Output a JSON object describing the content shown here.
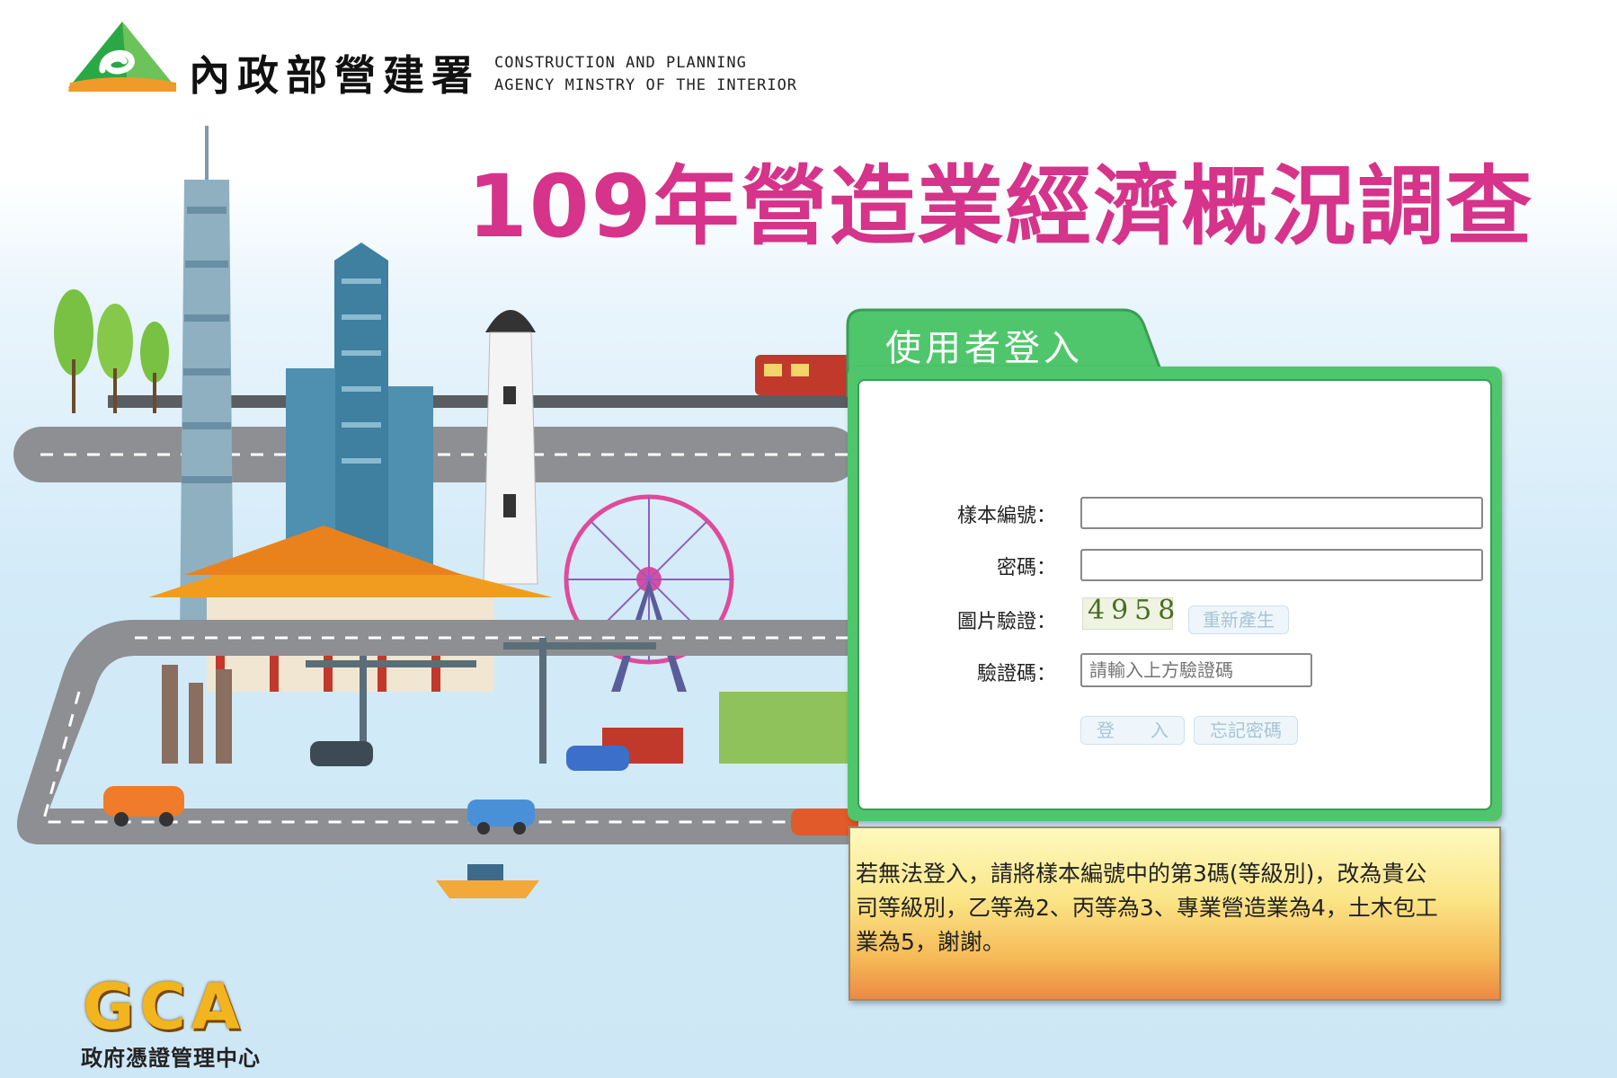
{
  "header": {
    "agency_name_zh": "內政部營建署",
    "agency_name_en_line1": "CONSTRUCTION AND PLANNING",
    "agency_name_en_line2": "AGENCY MINSTRY OF THE INTERIOR"
  },
  "survey": {
    "title": "109年營造業經濟概況調查"
  },
  "login": {
    "title": "使用者登入",
    "sample_id_label": "樣本編號：",
    "sample_id_value": "",
    "password_label": "密碼：",
    "password_value": "",
    "captcha_image_label": "圖片驗證：",
    "captcha_code": "4958",
    "regenerate_label": "重新產生",
    "captcha_input_label": "驗證碼：",
    "captcha_input_placeholder": "請輸入上方驗證碼",
    "captcha_input_value": "",
    "login_button_label": "登　　入",
    "forgot_password_label": "忘記密碼"
  },
  "notice": {
    "text": "若無法登入，請將樣本編號中的第3碼(等級別)，改為貴公司等級別，乙等為2、丙等為3、專業營造業為4，土木包工業為5，謝謝。"
  },
  "footer": {
    "gca_logo_text": "GCA",
    "gca_caption": "政府憑證管理中心"
  },
  "colors": {
    "title": "#d6338a",
    "login_green": "#4fc66b",
    "gca_gold": "#f2b51e"
  }
}
